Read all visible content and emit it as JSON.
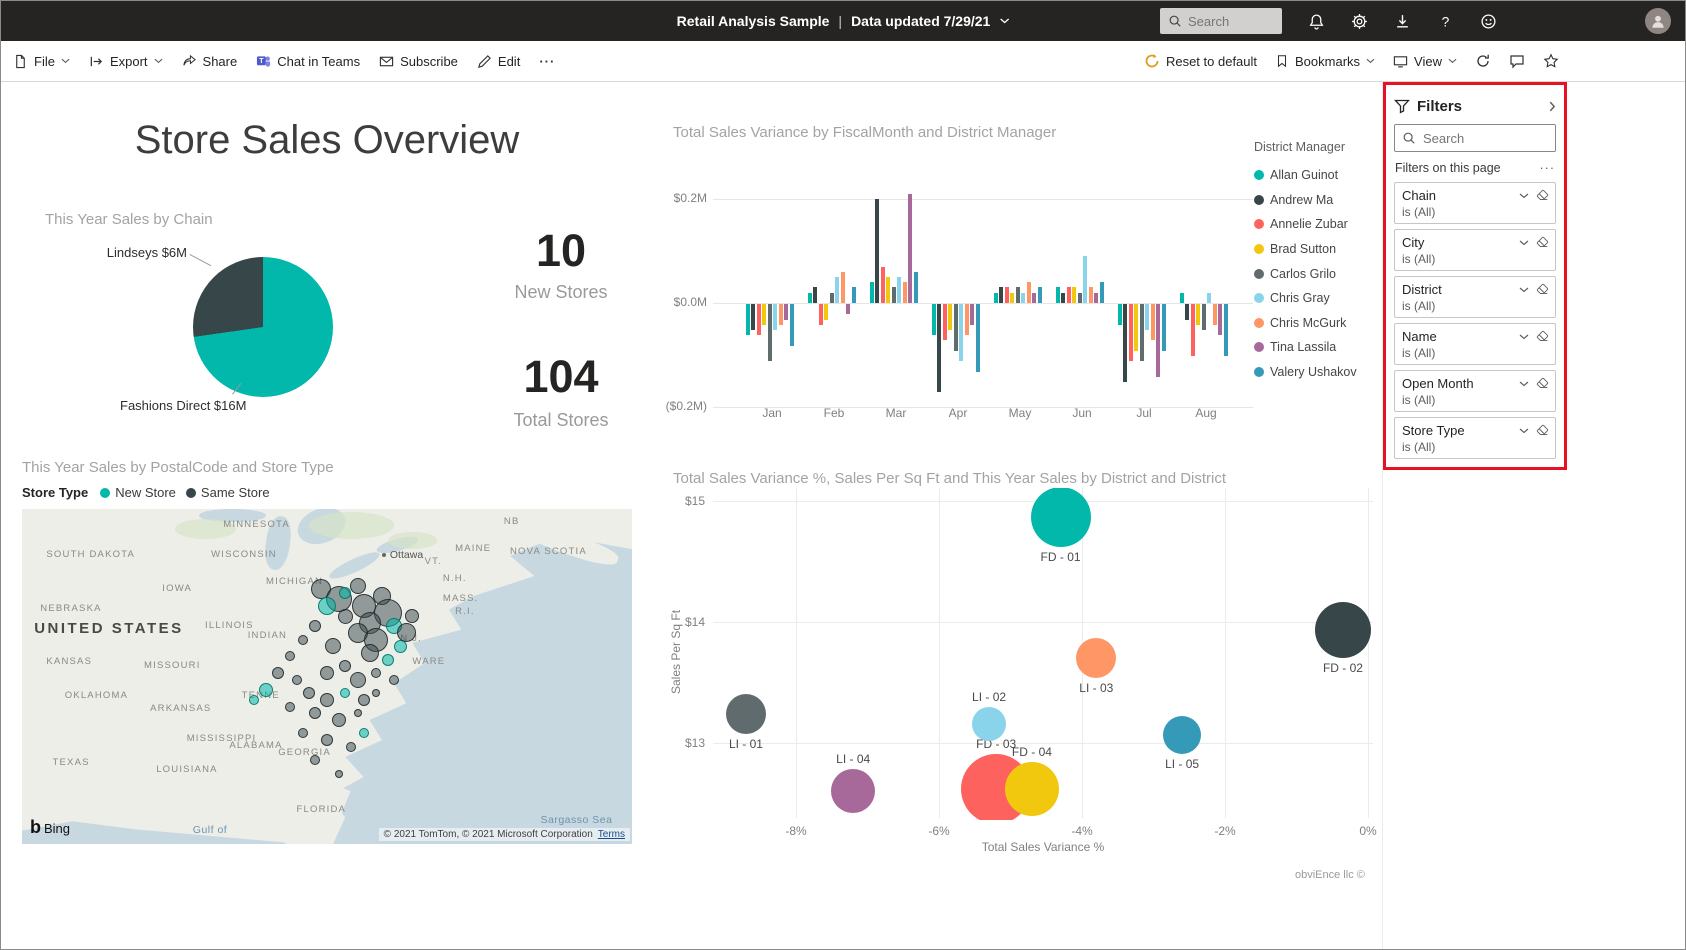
{
  "top_bar": {
    "title": "Retail Analysis Sample",
    "separator": "|",
    "updated": "Data updated 7/29/21",
    "search_placeholder": "Search"
  },
  "toolbar": {
    "file": "File",
    "export": "Export",
    "share": "Share",
    "chat_in_teams": "Chat in Teams",
    "subscribe": "Subscribe",
    "edit": "Edit",
    "more": "···",
    "reset_to_default": "Reset to default",
    "bookmarks": "Bookmarks",
    "view": "View"
  },
  "page": {
    "title": "Store Sales Overview",
    "attribution": "obviEnce llc ©"
  },
  "kpis": [
    {
      "value": "10",
      "label": "New Stores"
    },
    {
      "value": "104",
      "label": "Total Stores"
    }
  ],
  "filters_panel": {
    "title": "Filters",
    "search_placeholder": "Search",
    "section_label": "Filters on this page",
    "more": "···",
    "cards": [
      {
        "name": "Chain",
        "value": "is (All)"
      },
      {
        "name": "City",
        "value": "is (All)"
      },
      {
        "name": "District",
        "value": "is (All)"
      },
      {
        "name": "Name",
        "value": "is (All)"
      },
      {
        "name": "Open Month",
        "value": "is (All)"
      },
      {
        "name": "Store Type",
        "value": "is (All)"
      }
    ]
  },
  "chart_data": [
    {
      "type": "pie",
      "title": "This Year Sales by Chain",
      "slices": [
        {
          "label": "Fashions Direct",
          "value": 16,
          "unit": "$M",
          "value_label": "Fashions Direct $16M",
          "color": "#01B8AA"
        },
        {
          "label": "Lindseys",
          "value": 6,
          "unit": "$M",
          "value_label": "Lindseys $6M",
          "color": "#374649"
        }
      ]
    },
    {
      "type": "bar",
      "title": "Total Sales Variance by FiscalMonth and District Manager",
      "legend_title": "District Manager",
      "categories": [
        "Jan",
        "Feb",
        "Mar",
        "Apr",
        "May",
        "Jun",
        "Jul",
        "Aug"
      ],
      "y_ticks": [
        {
          "label": "$0.2M",
          "v": 0.2
        },
        {
          "label": "$0.0M",
          "v": 0
        },
        {
          "label": "($0.2M)",
          "v": -0.2
        }
      ],
      "ylim": [
        -0.25,
        0.25
      ],
      "unit": "M",
      "series": [
        {
          "name": "Allan Guinot",
          "color": "#01B8AA",
          "values": [
            -0.06,
            0.02,
            0.04,
            -0.06,
            0.02,
            0.03,
            -0.04,
            0.02
          ]
        },
        {
          "name": "Andrew Ma",
          "color": "#374649",
          "values": [
            -0.05,
            0.03,
            0.2,
            -0.17,
            0.03,
            0.02,
            -0.15,
            -0.03
          ]
        },
        {
          "name": "Annelie Zubar",
          "color": "#FD625E",
          "values": [
            -0.06,
            -0.04,
            0.07,
            -0.07,
            0.03,
            0.03,
            -0.11,
            -0.1
          ]
        },
        {
          "name": "Brad Sutton",
          "color": "#F2C80F",
          "values": [
            -0.04,
            -0.03,
            0.05,
            -0.05,
            0.02,
            0.03,
            -0.09,
            -0.04
          ]
        },
        {
          "name": "Carlos Grilo",
          "color": "#5F6B6D",
          "values": [
            -0.11,
            0.02,
            0.03,
            -0.09,
            0.03,
            0.02,
            -0.11,
            -0.05
          ]
        },
        {
          "name": "Chris Gray",
          "color": "#8AD4EB",
          "values": [
            -0.05,
            0.05,
            0.05,
            -0.11,
            0.02,
            0.09,
            -0.05,
            0.02
          ]
        },
        {
          "name": "Chris McGurk",
          "color": "#FE9666",
          "values": [
            -0.04,
            0.06,
            0.04,
            -0.06,
            0.04,
            0.03,
            -0.07,
            -0.04
          ]
        },
        {
          "name": "Tina Lassila",
          "color": "#A66999",
          "values": [
            -0.03,
            -0.02,
            0.21,
            -0.04,
            0.02,
            0.02,
            -0.14,
            -0.06
          ]
        },
        {
          "name": "Valery Ushakov",
          "color": "#3599B8",
          "values": [
            -0.08,
            0.03,
            0.06,
            -0.13,
            0.03,
            0.04,
            -0.09,
            -0.1
          ]
        }
      ]
    },
    {
      "type": "map",
      "title": "This Year Sales by PostalCode and Store Type",
      "legend_title": "Store Type",
      "legend": [
        {
          "label": "New Store",
          "color": "#01B8AA"
        },
        {
          "label": "Same Store",
          "color": "#374649"
        }
      ],
      "attribution": "© 2021 TomTom, © 2021 Microsoft Corporation",
      "terms_label": "Terms",
      "logo_label": "Bing",
      "labels": [
        {
          "text": "NB",
          "x": 79,
          "y": 2
        },
        {
          "text": "MAINE",
          "x": 71,
          "y": 10
        },
        {
          "text": "NOVA SCOTIA",
          "x": 80,
          "y": 11
        },
        {
          "text": "Ottawa",
          "x": 59,
          "y": 12,
          "kind": "city"
        },
        {
          "text": "VT.",
          "x": 66,
          "y": 14
        },
        {
          "text": "N.H.",
          "x": 69,
          "y": 19
        },
        {
          "text": "MINNESOTA",
          "x": 33,
          "y": 3
        },
        {
          "text": "WISCONSIN",
          "x": 31,
          "y": 12
        },
        {
          "text": "MICHIGAN",
          "x": 40,
          "y": 20
        },
        {
          "text": "IOWA",
          "x": 23,
          "y": 22
        },
        {
          "text": "SOUTH DAKOTA",
          "x": 4,
          "y": 12
        },
        {
          "text": "NEBRASKA",
          "x": 3,
          "y": 28
        },
        {
          "text": "ILLINOIS",
          "x": 30,
          "y": 33
        },
        {
          "text": "INDIAN",
          "x": 37,
          "y": 36
        },
        {
          "text": "MASS.",
          "x": 69,
          "y": 25
        },
        {
          "text": "R.I.",
          "x": 71,
          "y": 29
        },
        {
          "text": "N.J.",
          "x": 62,
          "y": 37
        },
        {
          "text": "WARE",
          "x": 64,
          "y": 44
        },
        {
          "text": "KANSAS",
          "x": 4,
          "y": 44
        },
        {
          "text": "MISSOURI",
          "x": 20,
          "y": 45
        },
        {
          "text": "OKLAHOMA",
          "x": 7,
          "y": 54
        },
        {
          "text": "TENNE",
          "x": 36,
          "y": 54
        },
        {
          "text": "ARKANSAS",
          "x": 21,
          "y": 58
        },
        {
          "text": "MISSISSIPPI",
          "x": 27,
          "y": 67
        },
        {
          "text": "ALABAMA",
          "x": 34,
          "y": 69
        },
        {
          "text": "GEORGIA",
          "x": 42,
          "y": 71
        },
        {
          "text": "TEXAS",
          "x": 5,
          "y": 74
        },
        {
          "text": "LOUISIANA",
          "x": 22,
          "y": 76
        },
        {
          "text": "FLORIDA",
          "x": 45,
          "y": 88
        },
        {
          "text": "UNITED STATES",
          "x": 2,
          "y": 33,
          "kind": "country"
        },
        {
          "text": "Gulf of",
          "x": 28,
          "y": 94,
          "kind": "water-lb"
        },
        {
          "text": "Sargasso Sea",
          "x": 85,
          "y": 91,
          "kind": "water-lb"
        }
      ],
      "points": [
        {
          "x": 49,
          "y": 24,
          "s": 20,
          "t": "same"
        },
        {
          "x": 52,
          "y": 27,
          "s": 26,
          "t": "same"
        },
        {
          "x": 55,
          "y": 23,
          "s": 16,
          "t": "same"
        },
        {
          "x": 56,
          "y": 29,
          "s": 24,
          "t": "same"
        },
        {
          "x": 59,
          "y": 26,
          "s": 18,
          "t": "same"
        },
        {
          "x": 60,
          "y": 31,
          "s": 28,
          "t": "same"
        },
        {
          "x": 57,
          "y": 34,
          "s": 22,
          "t": "same"
        },
        {
          "x": 53,
          "y": 32,
          "s": 15,
          "t": "same"
        },
        {
          "x": 55,
          "y": 37,
          "s": 20,
          "t": "same"
        },
        {
          "x": 58,
          "y": 39,
          "s": 24,
          "t": "same"
        },
        {
          "x": 61,
          "y": 35,
          "s": 16,
          "t": "new"
        },
        {
          "x": 62,
          "y": 41,
          "s": 13,
          "t": "new"
        },
        {
          "x": 48,
          "y": 35,
          "s": 12,
          "t": "same"
        },
        {
          "x": 46,
          "y": 39,
          "s": 10,
          "t": "same"
        },
        {
          "x": 51,
          "y": 41,
          "s": 16,
          "t": "same"
        },
        {
          "x": 57,
          "y": 43,
          "s": 18,
          "t": "same"
        },
        {
          "x": 60,
          "y": 45,
          "s": 12,
          "t": "new"
        },
        {
          "x": 63,
          "y": 37,
          "s": 19,
          "t": "same"
        },
        {
          "x": 64,
          "y": 32,
          "s": 14,
          "t": "same"
        },
        {
          "x": 50,
          "y": 29,
          "s": 18,
          "t": "new"
        },
        {
          "x": 53,
          "y": 25,
          "s": 12,
          "t": "new"
        },
        {
          "x": 44,
          "y": 44,
          "s": 10,
          "t": "same"
        },
        {
          "x": 42,
          "y": 49,
          "s": 12,
          "t": "same"
        },
        {
          "x": 40,
          "y": 54,
          "s": 14,
          "t": "new"
        },
        {
          "x": 45,
          "y": 51,
          "s": 10,
          "t": "same"
        },
        {
          "x": 50,
          "y": 49,
          "s": 14,
          "t": "same"
        },
        {
          "x": 53,
          "y": 47,
          "s": 12,
          "t": "same"
        },
        {
          "x": 55,
          "y": 51,
          "s": 16,
          "t": "same"
        },
        {
          "x": 58,
          "y": 49,
          "s": 10,
          "t": "same"
        },
        {
          "x": 47,
          "y": 55,
          "s": 12,
          "t": "same"
        },
        {
          "x": 50,
          "y": 57,
          "s": 14,
          "t": "same"
        },
        {
          "x": 53,
          "y": 55,
          "s": 10,
          "t": "new"
        },
        {
          "x": 56,
          "y": 57,
          "s": 12,
          "t": "same"
        },
        {
          "x": 44,
          "y": 59,
          "s": 10,
          "t": "same"
        },
        {
          "x": 48,
          "y": 61,
          "s": 12,
          "t": "same"
        },
        {
          "x": 52,
          "y": 63,
          "s": 14,
          "t": "same"
        },
        {
          "x": 55,
          "y": 61,
          "s": 8,
          "t": "same"
        },
        {
          "x": 38,
          "y": 57,
          "s": 10,
          "t": "new"
        },
        {
          "x": 46,
          "y": 67,
          "s": 10,
          "t": "same"
        },
        {
          "x": 50,
          "y": 69,
          "s": 12,
          "t": "same"
        },
        {
          "x": 54,
          "y": 71,
          "s": 10,
          "t": "same"
        },
        {
          "x": 48,
          "y": 75,
          "s": 10,
          "t": "same"
        },
        {
          "x": 52,
          "y": 79,
          "s": 8,
          "t": "same"
        },
        {
          "x": 56,
          "y": 67,
          "s": 10,
          "t": "new"
        },
        {
          "x": 58,
          "y": 55,
          "s": 8,
          "t": "same"
        },
        {
          "x": 61,
          "y": 51,
          "s": 10,
          "t": "same"
        }
      ]
    },
    {
      "type": "scatter",
      "title": "Total Sales Variance %, Sales Per Sq Ft and This Year Sales by District and District",
      "xlabel": "Total Sales Variance %",
      "ylabel": "Sales Per Sq Ft",
      "x_ticks": [
        {
          "label": "-8%",
          "v": -8
        },
        {
          "label": "-6%",
          "v": -6
        },
        {
          "label": "-4%",
          "v": -4
        },
        {
          "label": "-2%",
          "v": -2
        },
        {
          "label": "0%",
          "v": 0
        }
      ],
      "y_ticks": [
        {
          "label": "$15",
          "v": 15
        },
        {
          "label": "$14",
          "v": 14
        },
        {
          "label": "$13",
          "v": 13
        }
      ],
      "points": [
        {
          "label": "LI - 01",
          "x": -8.7,
          "y": 13.24,
          "r": 20,
          "color": "#5F6B6D",
          "label_pos": "below"
        },
        {
          "label": "LI - 04",
          "x": -7.2,
          "y": 12.6,
          "r": 22,
          "color": "#A66999",
          "label_pos": "above"
        },
        {
          "label": "FD - 03",
          "x": -5.2,
          "y": 12.62,
          "r": 35,
          "color": "#FD625E",
          "label_pos": "above"
        },
        {
          "label": "FD - 04",
          "x": -4.7,
          "y": 12.62,
          "r": 27,
          "color": "#F2C80F",
          "label_pos": "above"
        },
        {
          "label": "LI - 02",
          "x": -5.3,
          "y": 13.16,
          "r": 17,
          "color": "#8AD4EB",
          "label_pos": "above"
        },
        {
          "label": "LI - 03",
          "x": -3.8,
          "y": 13.7,
          "r": 20,
          "color": "#FE9666",
          "label_pos": "below"
        },
        {
          "label": "FD - 01",
          "x": -4.3,
          "y": 14.87,
          "r": 30,
          "color": "#01B8AA",
          "label_pos": "below"
        },
        {
          "label": "FD - 02",
          "x": -0.35,
          "y": 13.93,
          "r": 28,
          "color": "#374649",
          "label_pos": "below"
        },
        {
          "label": "LI - 05",
          "x": -2.6,
          "y": 13.07,
          "r": 19,
          "color": "#3599B8",
          "label_pos": "below"
        }
      ]
    }
  ]
}
